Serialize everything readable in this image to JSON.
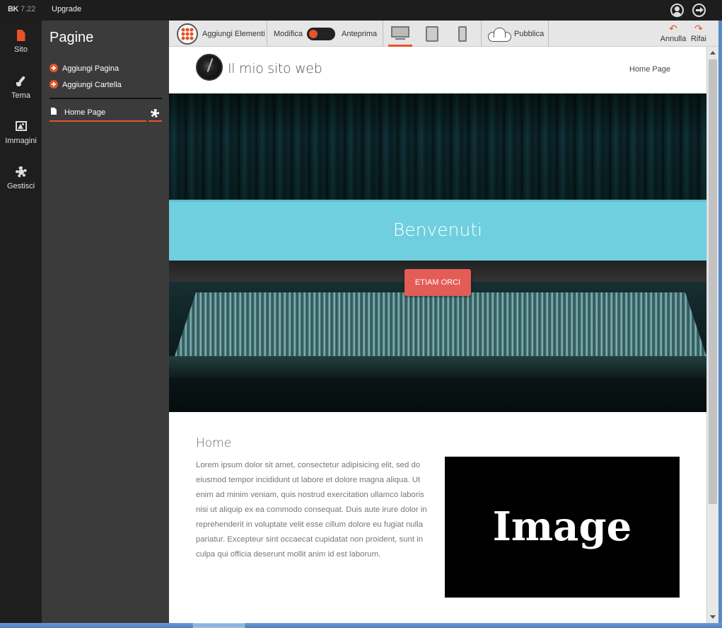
{
  "app": {
    "logo_mark": "BK",
    "version": "7.22",
    "upgrade_label": "Upgrade",
    "accent_color": "#e8532a"
  },
  "top_icons": [
    "user-icon",
    "logout-icon"
  ],
  "rail": {
    "items": [
      {
        "label": "Sito",
        "icon": "page-icon",
        "active": true
      },
      {
        "label": "Tema",
        "icon": "brush-icon",
        "active": false
      },
      {
        "label": "Immagini",
        "icon": "image-icon",
        "active": false
      },
      {
        "label": "Gestisci",
        "icon": "gear-icon",
        "active": false
      }
    ]
  },
  "pages_panel": {
    "title": "Pagine",
    "actions": [
      "Aggiungi Pagina",
      "Aggiungi Cartella"
    ],
    "pages": [
      {
        "label": "Home Page",
        "selected": true
      }
    ]
  },
  "toolbar": {
    "add_elements_label": "Aggiungi Elementi",
    "edit_label": "Modifica",
    "preview_label": "Anteprima",
    "devices": [
      "desktop",
      "tablet",
      "phone"
    ],
    "active_device": "desktop",
    "publish_label": "Pubblica",
    "undo_label": "Annulla",
    "redo_label": "Rifai"
  },
  "site": {
    "title": "Il mio sito web",
    "nav_items": [
      "Home Page"
    ],
    "hero": {
      "banner_text": "Benvenuti",
      "cta_label": "ETIAM ORCI",
      "banner_color": "#6fcfde",
      "cta_color": "#e45c56"
    },
    "section": {
      "title": "Home",
      "body": "Lorem ipsum dolor sit amet, consectetur adipisicing elit, sed do eiusmod tempor incididunt ut labore et dolore magna aliqua. Ut enim ad minim veniam, quis nostrud exercitation ullamco laboris nisi ut aliquip ex ea commodo consequat. Duis aute irure dolor in reprehenderit in voluptate velit esse cillum dolore eu fugiat nulla pariatur. Excepteur sint occaecat cupidatat non proident, sunt in culpa qui officia deserunt mollit anim id est laborum.",
      "image_placeholder": "Image"
    }
  }
}
